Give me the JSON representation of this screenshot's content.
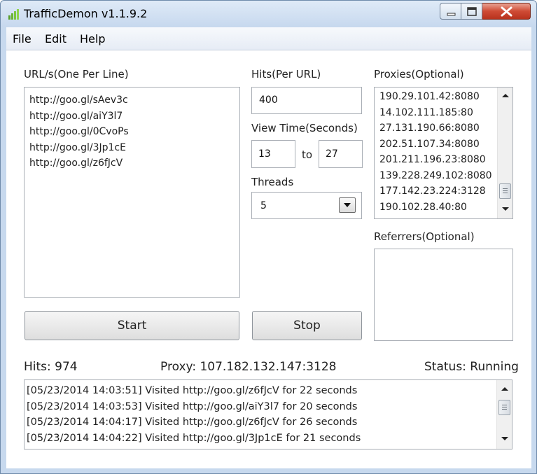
{
  "window": {
    "title": "TrafficDemon v1.1.9.2",
    "menu": [
      "File",
      "Edit",
      "Help"
    ]
  },
  "urls": {
    "label": "URL/s(One Per Line)",
    "lines": [
      "http://goo.gl/sAev3c",
      "http://goo.gl/aiY3l7",
      "http://goo.gl/0CvoPs",
      "http://goo.gl/3Jp1cE",
      "http://goo.gl/z6fJcV"
    ]
  },
  "hits": {
    "label": "Hits(Per URL)",
    "value": "400"
  },
  "view_time": {
    "label": "View Time(Seconds)",
    "min": "13",
    "to_label": "to",
    "max": "27"
  },
  "threads": {
    "label": "Threads",
    "value": "5"
  },
  "proxies": {
    "label": "Proxies(Optional)",
    "lines": [
      "190.29.101.42:8080",
      "14.102.111.185:80",
      "27.131.190.66:8080",
      "202.51.107.34:8080",
      "201.211.196.23:8080",
      "139.228.249.102:8080",
      "177.142.23.224:3128",
      "190.102.28.40:80"
    ]
  },
  "referrers": {
    "label": "Referrers(Optional)",
    "lines": []
  },
  "buttons": {
    "start": "Start",
    "stop": "Stop"
  },
  "status_bar": {
    "hits": "Hits: 974",
    "proxy": "Proxy: 107.182.132.147:3128",
    "status": "Status: Running"
  },
  "log": {
    "lines": [
      "[05/23/2014 14:03:51] Visited http://goo.gl/z6fJcV for 22 seconds",
      "[05/23/2014 14:03:53] Visited http://goo.gl/aiY3l7 for 20 seconds",
      "[05/23/2014 14:04:17] Visited http://goo.gl/z6fJcV for 26 seconds",
      "[05/23/2014 14:04:22] Visited http://goo.gl/3Jp1cE for 21 seconds"
    ]
  },
  "colors": {
    "frame": "#c7d9ee",
    "close_button": "#cf4b35",
    "icon_green": "#5aa02c"
  },
  "icons": {
    "app": "signal-bars-icon",
    "minimize": "minimize-icon",
    "maximize": "maximize-icon",
    "close": "close-icon"
  }
}
